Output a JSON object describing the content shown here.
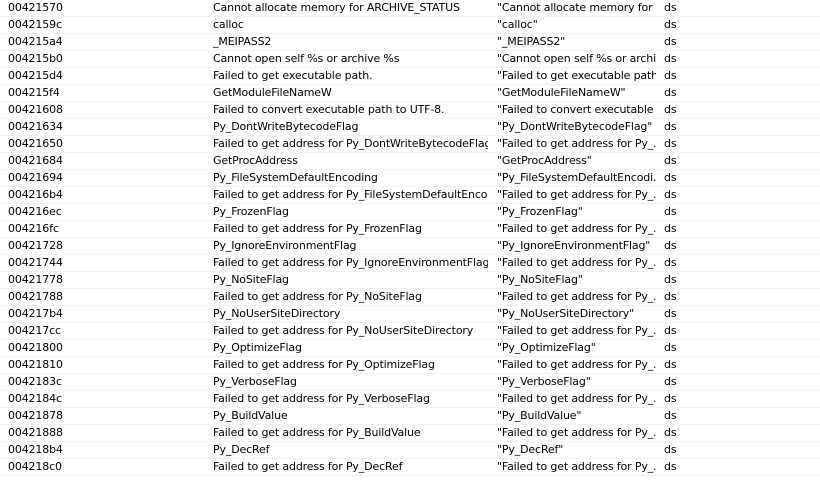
{
  "rows": [
    {
      "address": "00421570",
      "string": "Cannot allocate memory for ARCHIVE_STATUS",
      "value": "\"Cannot allocate memory for ...",
      "type": "ds"
    },
    {
      "address": "0042159c",
      "string": "calloc",
      "value": "\"calloc\"",
      "type": "ds"
    },
    {
      "address": "004215a4",
      "string": "_MEIPASS2",
      "value": "\"_MEIPASS2\"",
      "type": "ds"
    },
    {
      "address": "004215b0",
      "string": "Cannot open self %s or archive %s",
      "value": "\"Cannot open self %s or archi...",
      "type": "ds"
    },
    {
      "address": "004215d4",
      "string": "Failed to get executable path.",
      "value": "\"Failed to get executable path.\"",
      "type": "ds"
    },
    {
      "address": "004215f4",
      "string": "GetModuleFileNameW",
      "value": "\"GetModuleFileNameW\"",
      "type": "ds"
    },
    {
      "address": "00421608",
      "string": "Failed to convert executable path to UTF-8.",
      "value": "\"Failed to convert executable ...",
      "type": "ds"
    },
    {
      "address": "00421634",
      "string": "Py_DontWriteBytecodeFlag",
      "value": "\"Py_DontWriteBytecodeFlag\"",
      "type": "ds"
    },
    {
      "address": "00421650",
      "string": "Failed to get address for Py_DontWriteBytecodeFlag",
      "value": "\"Failed to get address for Py_...",
      "type": "ds"
    },
    {
      "address": "00421684",
      "string": "GetProcAddress",
      "value": "\"GetProcAddress\"",
      "type": "ds"
    },
    {
      "address": "00421694",
      "string": "Py_FileSystemDefaultEncoding",
      "value": "\"Py_FileSystemDefaultEncodi...",
      "type": "ds"
    },
    {
      "address": "004216b4",
      "string": "Failed to get address for Py_FileSystemDefaultEncoding",
      "value": "\"Failed to get address for Py_...",
      "type": "ds"
    },
    {
      "address": "004216ec",
      "string": "Py_FrozenFlag",
      "value": "\"Py_FrozenFlag\"",
      "type": "ds"
    },
    {
      "address": "004216fc",
      "string": "Failed to get address for Py_FrozenFlag",
      "value": "\"Failed to get address for Py_...",
      "type": "ds"
    },
    {
      "address": "00421728",
      "string": "Py_IgnoreEnvironmentFlag",
      "value": "\"Py_IgnoreEnvironmentFlag\"",
      "type": "ds"
    },
    {
      "address": "00421744",
      "string": "Failed to get address for Py_IgnoreEnvironmentFlag",
      "value": "\"Failed to get address for Py_...",
      "type": "ds"
    },
    {
      "address": "00421778",
      "string": "Py_NoSiteFlag",
      "value": "\"Py_NoSiteFlag\"",
      "type": "ds"
    },
    {
      "address": "00421788",
      "string": "Failed to get address for Py_NoSiteFlag",
      "value": "\"Failed to get address for Py_...",
      "type": "ds"
    },
    {
      "address": "004217b4",
      "string": "Py_NoUserSiteDirectory",
      "value": "\"Py_NoUserSiteDirectory\"",
      "type": "ds"
    },
    {
      "address": "004217cc",
      "string": "Failed to get address for Py_NoUserSiteDirectory",
      "value": "\"Failed to get address for Py_...",
      "type": "ds"
    },
    {
      "address": "00421800",
      "string": "Py_OptimizeFlag",
      "value": "\"Py_OptimizeFlag\"",
      "type": "ds"
    },
    {
      "address": "00421810",
      "string": "Failed to get address for Py_OptimizeFlag",
      "value": "\"Failed to get address for Py_...",
      "type": "ds"
    },
    {
      "address": "0042183c",
      "string": "Py_VerboseFlag",
      "value": "\"Py_VerboseFlag\"",
      "type": "ds"
    },
    {
      "address": "0042184c",
      "string": "Failed to get address for Py_VerboseFlag",
      "value": "\"Failed to get address for Py_...",
      "type": "ds"
    },
    {
      "address": "00421878",
      "string": "Py_BuildValue",
      "value": "\"Py_BuildValue\"",
      "type": "ds"
    },
    {
      "address": "00421888",
      "string": "Failed to get address for Py_BuildValue",
      "value": "\"Failed to get address for Py_...",
      "type": "ds"
    },
    {
      "address": "004218b4",
      "string": "Py_DecRef",
      "value": "\"Py_DecRef\"",
      "type": "ds"
    },
    {
      "address": "004218c0",
      "string": "Failed to get address for Py_DecRef",
      "value": "\"Failed to get address for Py_...",
      "type": "ds"
    }
  ]
}
